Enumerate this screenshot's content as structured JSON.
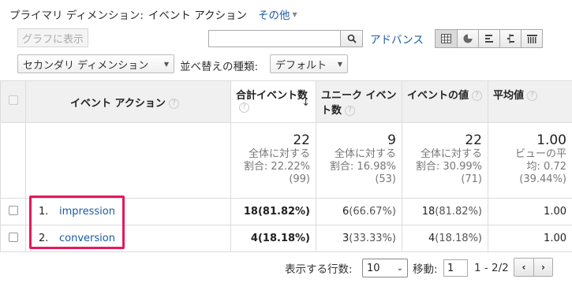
{
  "header": {
    "primary_dimension_label": "プライマリ ディメンション:",
    "primary_dimension_value": "イベント アクション",
    "other_link": "その他"
  },
  "toolbar": {
    "graph_button": "グラフに表示",
    "search": {
      "value": "",
      "placeholder": ""
    },
    "advanced_link": "アドバンス",
    "views": [
      "table-view-icon",
      "pie-view-icon",
      "performance-view-icon",
      "comparison-view-icon",
      "pivot-view-icon"
    ]
  },
  "secondary": {
    "secondary_dimension": "セカンダリ ディメンション",
    "sort_label": "並べ替えの種類:",
    "sort_value": "デフォルト"
  },
  "table": {
    "columns": {
      "action": "イベント アクション",
      "total_events": "合計イベント数",
      "unique_events": "ユニーク イベント数",
      "event_value": "イベントの値",
      "avg_value": "平均値"
    },
    "totals": {
      "total_events": {
        "value": "22",
        "l1": "全体に対する",
        "l2": "割合: 22.22%",
        "l3": "(99)"
      },
      "unique_events": {
        "value": "9",
        "l1": "全体に対する",
        "l2": "割合: 16.98%",
        "l3": "(53)"
      },
      "event_value": {
        "value": "22",
        "l1": "全体に対する",
        "l2": "割合: 30.99%",
        "l3": "(71)"
      },
      "avg_value": {
        "value": "1.00",
        "l1": "ビューの平",
        "l2": "均: 0.72",
        "l3": "(39.44%)"
      }
    },
    "rows": [
      {
        "index": "1.",
        "name": "impression",
        "total": "18",
        "total_pct": "(81.82%)",
        "unique": "6",
        "unique_pct": "(66.67%)",
        "value": "18",
        "value_pct": "(81.82%)",
        "avg": "1.00"
      },
      {
        "index": "2.",
        "name": "conversion",
        "total": "4",
        "total_pct": "(18.18%)",
        "unique": "3",
        "unique_pct": "(33.33%)",
        "value": "4",
        "value_pct": "(18.18%)",
        "avg": "1.00"
      }
    ]
  },
  "pager": {
    "rows_label": "表示する行数:",
    "rows_value": "10",
    "goto_label": "移動:",
    "goto_value": "1",
    "range": "1 - 2/2"
  },
  "colors": {
    "link": "#1a5ba6",
    "highlight": "#e8185b"
  }
}
